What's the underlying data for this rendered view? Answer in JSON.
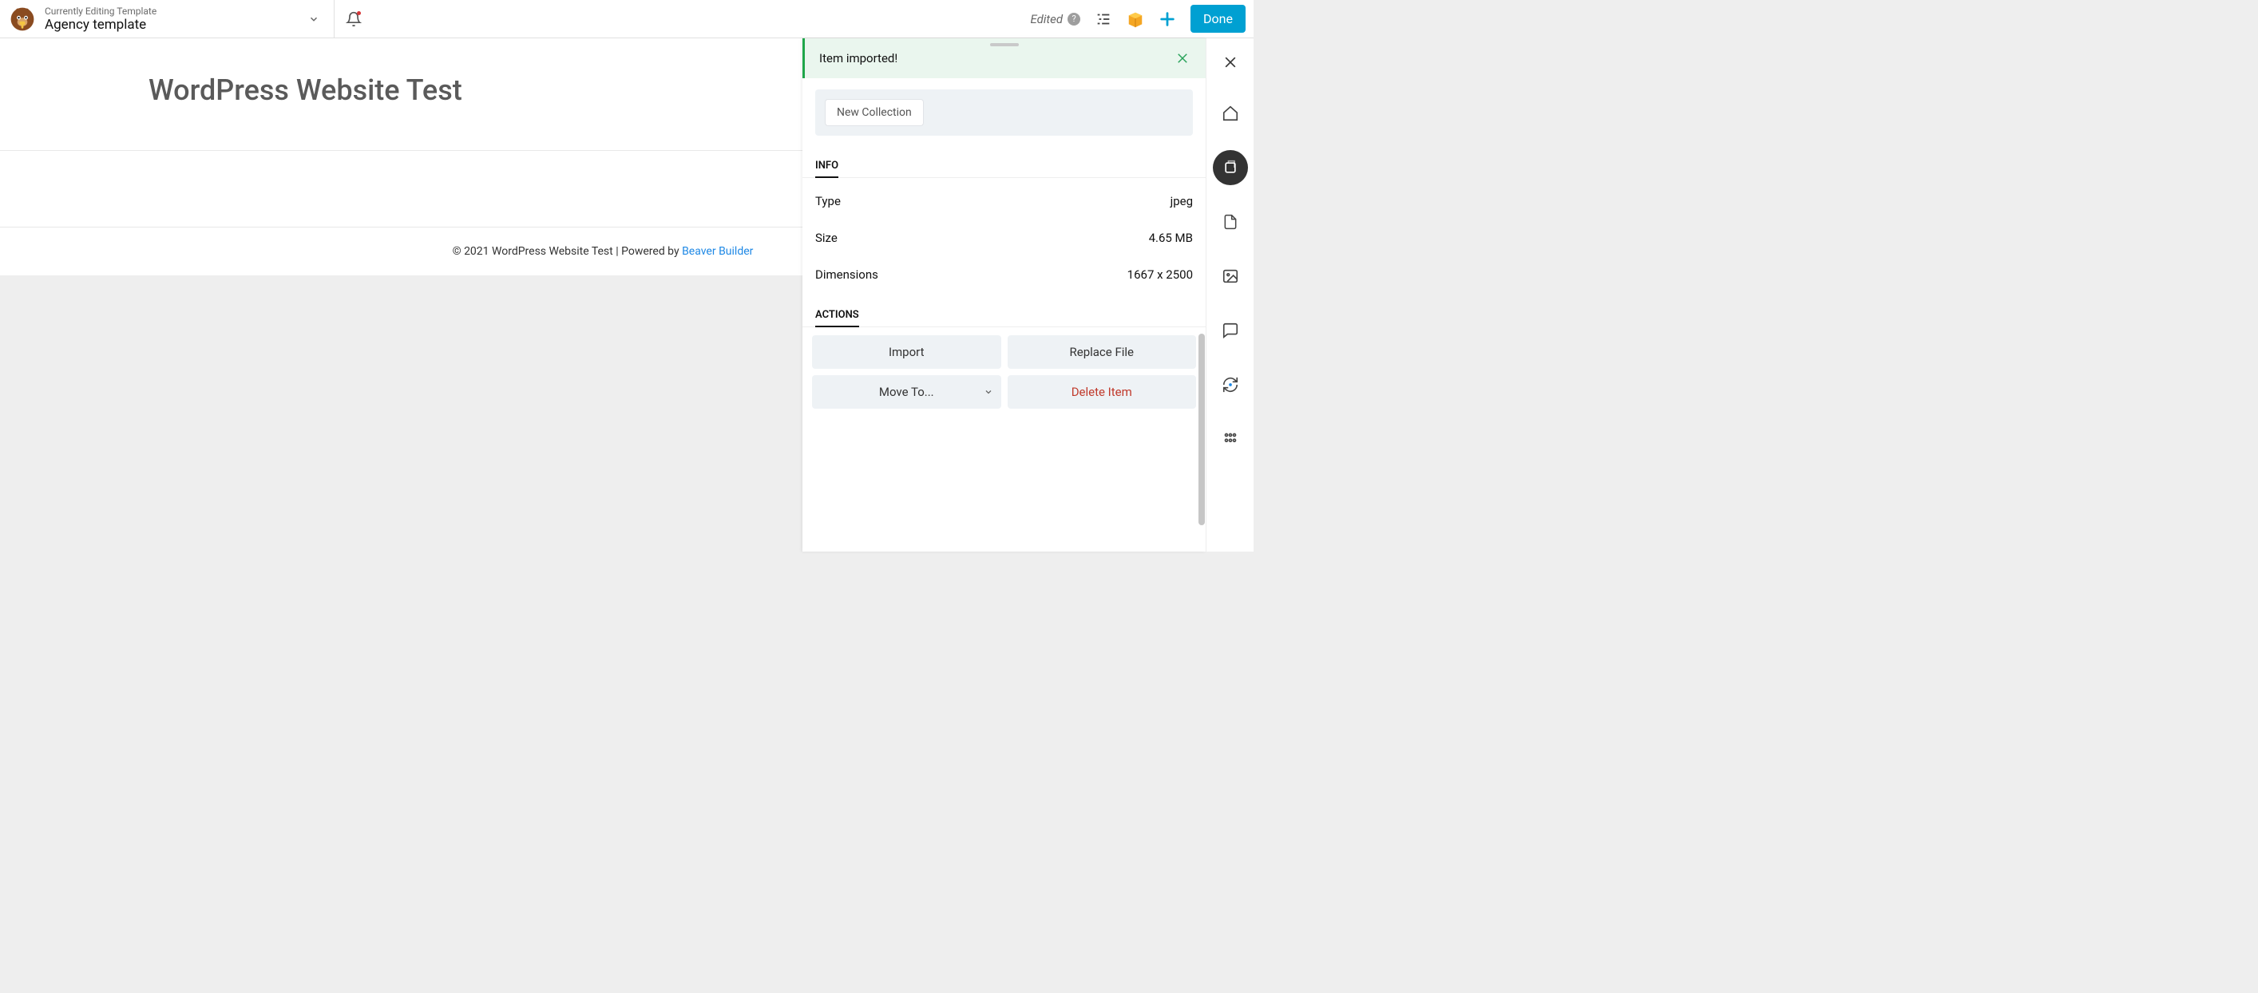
{
  "topbar": {
    "subtitle": "Currently Editing Template",
    "title": "Agency template",
    "edited_label": "Edited",
    "done_label": "Done"
  },
  "page": {
    "heading": "WordPress Website Test",
    "footer_prefix": "© 2021 WordPress Website Test | Powered by ",
    "footer_link": "Beaver Builder"
  },
  "panel": {
    "toast": "Item imported!",
    "collection_pill": "New Collection",
    "info_label": "INFO",
    "info": {
      "type_label": "Type",
      "type_value": "jpeg",
      "size_label": "Size",
      "size_value": "4.65 MB",
      "dims_label": "Dimensions",
      "dims_value": "1667 x 2500"
    },
    "actions_label": "ACTIONS",
    "actions": {
      "import": "Import",
      "replace": "Replace File",
      "move_to": "Move To...",
      "delete": "Delete Item"
    }
  }
}
